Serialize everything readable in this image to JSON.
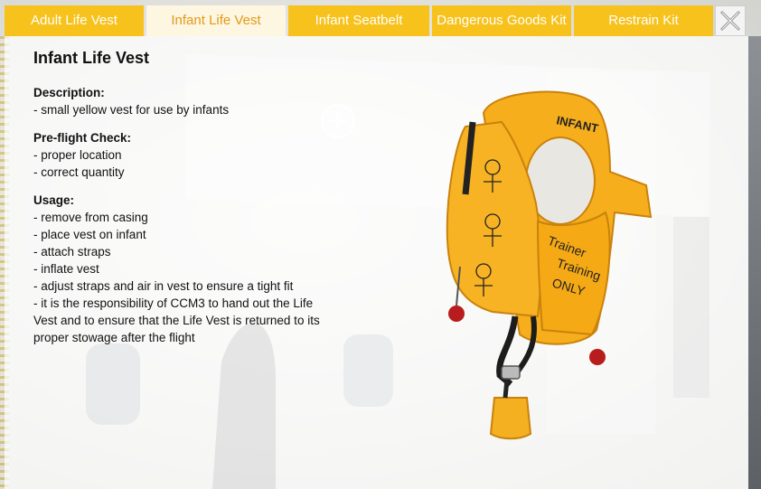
{
  "tabs": [
    {
      "label": "Adult Life Vest",
      "active": false
    },
    {
      "label": "Infant Life Vest",
      "active": true
    },
    {
      "label": "Infant Seatbelt",
      "active": false
    },
    {
      "label": "Dangerous Goods Kit",
      "active": false
    },
    {
      "label": "Restrain Kit",
      "active": false
    }
  ],
  "close": {
    "icon": "close-icon"
  },
  "content": {
    "title": "Infant Life Vest",
    "description": {
      "label": "Description:",
      "lines": [
        "- small yellow vest for use by infants"
      ]
    },
    "preflight": {
      "label": "Pre-flight Check:",
      "lines": [
        "- proper location",
        "- correct quantity"
      ]
    },
    "usage": {
      "label": "Usage:",
      "lines": [
        "- remove from casing",
        "- place vest on infant",
        "- attach straps",
        "- inflate vest",
        "- adjust straps and air in vest to ensure a tight fit",
        "- it is the responsibility of CCM3 to hand out the Life",
        "Vest and to ensure that the Life Vest is returned to its",
        "proper stowage after the flight"
      ]
    }
  },
  "vest_image": {
    "label_top": "INFANT",
    "handwriting": [
      "Trainer",
      "Training",
      "ONLY"
    ]
  },
  "colors": {
    "tab": "#f7c21c",
    "tab_active_bg": "#fdf6e0",
    "tab_active_text": "#e39a18",
    "vest": "#f6ae1c"
  }
}
